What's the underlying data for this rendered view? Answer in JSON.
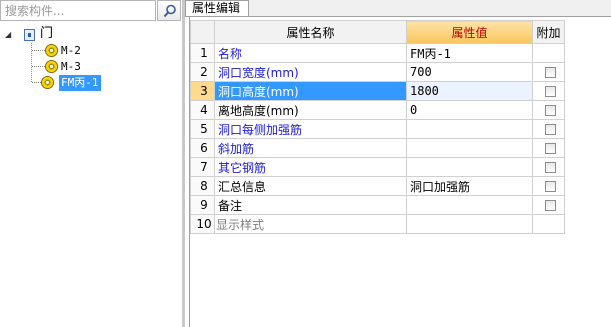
{
  "search": {
    "placeholder": "搜索构件...",
    "icon": "search-icon"
  },
  "tree": {
    "root": {
      "label": "门",
      "toggle": "◢",
      "icon": "component-folder-icon"
    },
    "children": [
      {
        "label": "M-2",
        "icon": "gear-icon",
        "selected": false
      },
      {
        "label": "M-3",
        "icon": "gear-icon",
        "selected": false
      },
      {
        "label": "FM丙-1",
        "icon": "gear-icon",
        "selected": true
      }
    ]
  },
  "tab": {
    "label": "属性编辑"
  },
  "grid": {
    "headers": {
      "num": "",
      "name": "属性名称",
      "value": "属性值",
      "extra": "附加"
    },
    "rows": [
      {
        "num": "1",
        "name": "名称",
        "value": "FM丙-1",
        "checkbox": false
      },
      {
        "num": "2",
        "name": "洞口宽度(mm)",
        "value": "700",
        "checkbox": true
      },
      {
        "num": "3",
        "name": "洞口高度(mm)",
        "value": "1800",
        "checkbox": true
      },
      {
        "num": "4",
        "name": "离地高度(mm)",
        "value": "0",
        "checkbox": true
      },
      {
        "num": "5",
        "name": "洞口每侧加强筋",
        "value": "",
        "checkbox": true
      },
      {
        "num": "6",
        "name": "斜加筋",
        "value": "",
        "checkbox": true
      },
      {
        "num": "7",
        "name": "其它钢筋",
        "value": "",
        "checkbox": true
      },
      {
        "num": "8",
        "name": "汇总信息",
        "value": "洞口加强筋",
        "checkbox": true
      },
      {
        "num": "9",
        "name": "备注",
        "value": "",
        "checkbox": true
      },
      {
        "num": "10",
        "name": "显示样式",
        "value": "",
        "checkbox": false,
        "expander": "+"
      }
    ]
  },
  "colors": {
    "selection": "#3399ff",
    "link_blue": "#1a1ad4",
    "header_value": "#c00000",
    "header_value_bg": "#f9c65c"
  }
}
